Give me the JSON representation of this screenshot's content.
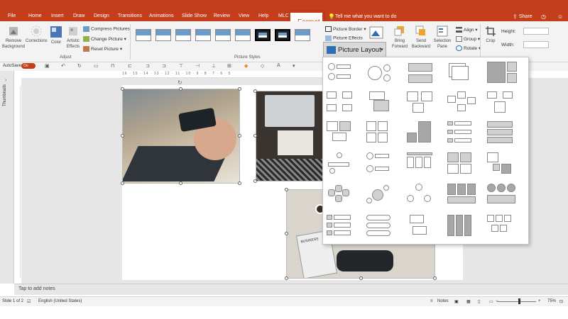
{
  "tabs": [
    "File",
    "Home",
    "Insert",
    "Draw",
    "Design",
    "Transitions",
    "Animations",
    "Slide Show",
    "Review",
    "View",
    "Help",
    "MLC"
  ],
  "active_tab": "Format",
  "tell_me": "Tell me what you want to do",
  "share": "Share",
  "ribbon": {
    "remove_background": "Remove Background",
    "corrections": "Corrections",
    "color": "Color",
    "artistic_effects": "Artistic Effects",
    "compress_pictures": "Compress Pictures",
    "change_picture": "Change Picture",
    "reset_picture": "Reset Picture",
    "adjust_group": "Adjust",
    "picture_styles_group": "Picture Styles",
    "picture_border": "Picture Border",
    "picture_effects": "Picture Effects",
    "picture_layout": "Picture Layout",
    "bring_forward": "Bring Forward",
    "send_backward": "Send Backward",
    "selection_pane": "Selection Pane",
    "align": "Align",
    "group": "Group",
    "rotate": "Rotate",
    "crop": "Crop",
    "height_label": "Height:",
    "width_label": "Width:"
  },
  "qat": {
    "autosave": "AutoSave",
    "toggle": "On"
  },
  "ruler_text": "16 · 15 · 14 · 13 · 12 · 11 · 10 · 9 · 8 · 7 · 6 · 5",
  "thumbnails_label": "Thumbnails",
  "notes_placeholder": "Tap to add notes",
  "status": {
    "slide": "Slide 1 of 2",
    "language": "English (United States)",
    "notes": "Notes",
    "zoom": "75%"
  },
  "pic3_text": "BUSINESS"
}
